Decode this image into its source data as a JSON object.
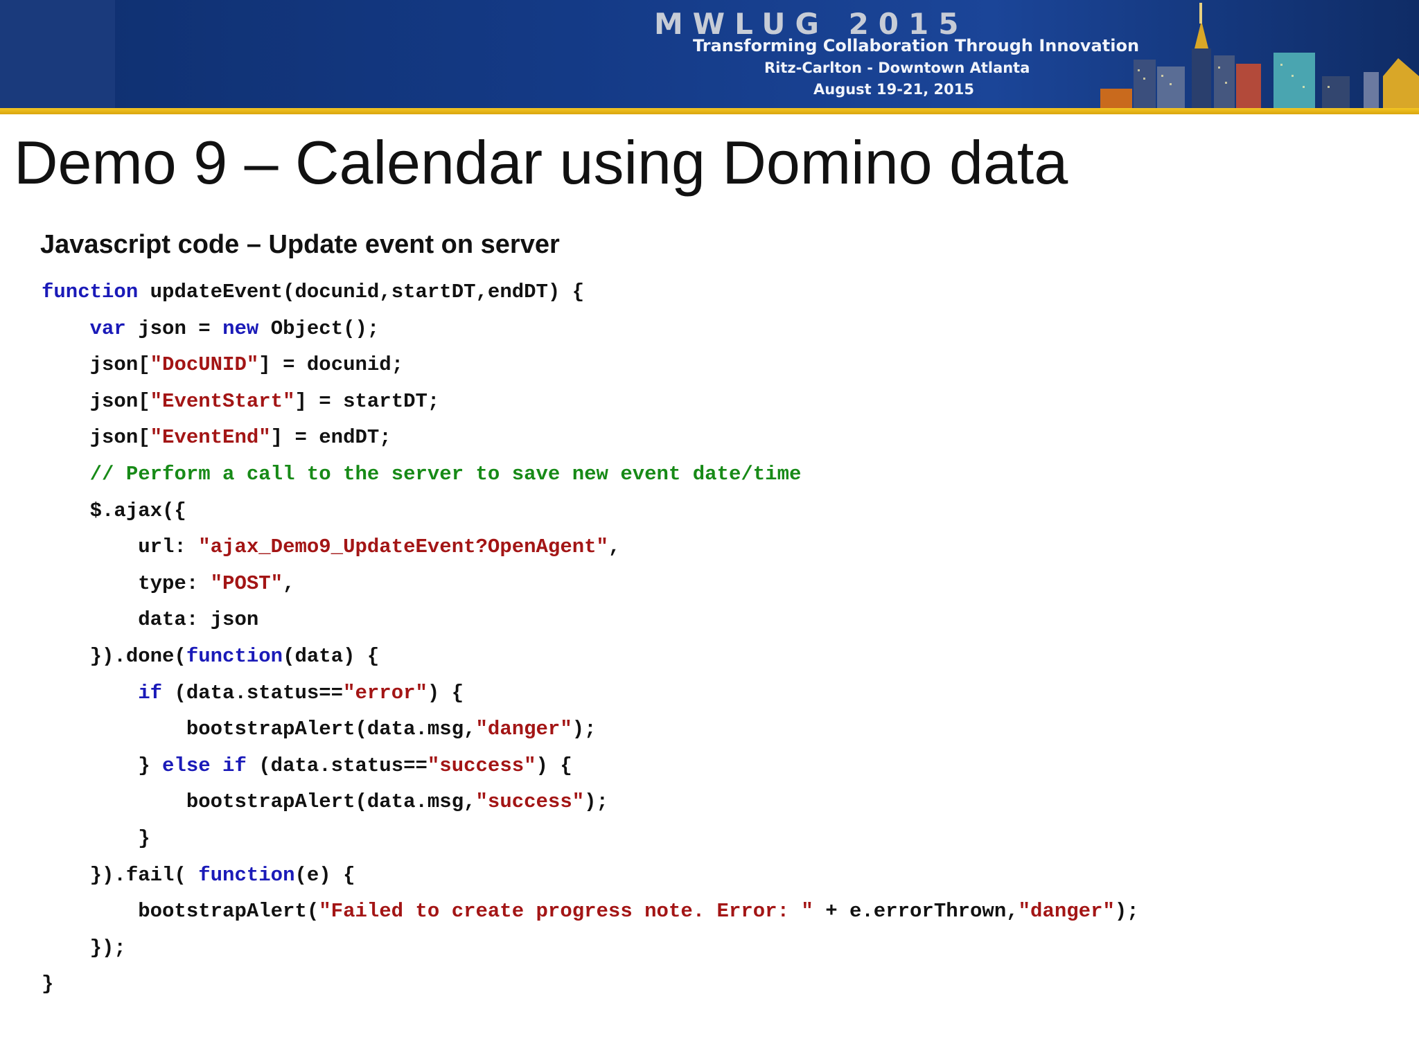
{
  "banner": {
    "conference": "MWLUG 2015",
    "tagline": "Transforming Collaboration Through Innovation",
    "venue": "Ritz-Carlton - Downtown Atlanta",
    "dates": "August 19-21, 2015",
    "colors": {
      "banner": "#143a86",
      "accent_bar": "#e6b414"
    }
  },
  "slide": {
    "title": "Demo 9 – Calendar using Domino data",
    "subtitle": "Javascript code – Update event on server"
  },
  "code": {
    "colors": {
      "keyword": "#1a1ab8",
      "string": "#a31515",
      "comment": "#178a17",
      "plain": "#111111"
    },
    "lines": [
      [
        {
          "t": "kw",
          "v": "function"
        },
        {
          "t": "p",
          "v": " updateEvent(docunid,startDT,endDT) {"
        }
      ],
      [
        {
          "t": "p",
          "v": "    "
        },
        {
          "t": "kw",
          "v": "var"
        },
        {
          "t": "p",
          "v": " json = "
        },
        {
          "t": "kw",
          "v": "new"
        },
        {
          "t": "p",
          "v": " Object();"
        }
      ],
      [
        {
          "t": "p",
          "v": "    json["
        },
        {
          "t": "str",
          "v": "\"DocUNID\""
        },
        {
          "t": "p",
          "v": "] = docunid;"
        }
      ],
      [
        {
          "t": "p",
          "v": "    json["
        },
        {
          "t": "str",
          "v": "\"EventStart\""
        },
        {
          "t": "p",
          "v": "] = startDT;"
        }
      ],
      [
        {
          "t": "p",
          "v": "    json["
        },
        {
          "t": "str",
          "v": "\"EventEnd\""
        },
        {
          "t": "p",
          "v": "] = endDT;"
        }
      ],
      [
        {
          "t": "p",
          "v": "    "
        },
        {
          "t": "cm",
          "v": "// Perform a call to the server to save new event date/time"
        }
      ],
      [
        {
          "t": "p",
          "v": "    $.ajax({"
        }
      ],
      [
        {
          "t": "p",
          "v": "        url: "
        },
        {
          "t": "str",
          "v": "\"ajax_Demo9_UpdateEvent?OpenAgent\""
        },
        {
          "t": "p",
          "v": ","
        }
      ],
      [
        {
          "t": "p",
          "v": "        type: "
        },
        {
          "t": "str",
          "v": "\"POST\""
        },
        {
          "t": "p",
          "v": ","
        }
      ],
      [
        {
          "t": "p",
          "v": "        data: json"
        }
      ],
      [
        {
          "t": "p",
          "v": "    }).done("
        },
        {
          "t": "kw",
          "v": "function"
        },
        {
          "t": "p",
          "v": "(data) {"
        }
      ],
      [
        {
          "t": "p",
          "v": "        "
        },
        {
          "t": "kw",
          "v": "if"
        },
        {
          "t": "p",
          "v": " (data.status=="
        },
        {
          "t": "str",
          "v": "\"error\""
        },
        {
          "t": "p",
          "v": ") {"
        }
      ],
      [
        {
          "t": "p",
          "v": "            bootstrapAlert(data.msg,"
        },
        {
          "t": "str",
          "v": "\"danger\""
        },
        {
          "t": "p",
          "v": ");"
        }
      ],
      [
        {
          "t": "p",
          "v": "        } "
        },
        {
          "t": "kw",
          "v": "else if"
        },
        {
          "t": "p",
          "v": " (data.status=="
        },
        {
          "t": "str",
          "v": "\"success\""
        },
        {
          "t": "p",
          "v": ") {"
        }
      ],
      [
        {
          "t": "p",
          "v": "            bootstrapAlert(data.msg,"
        },
        {
          "t": "str",
          "v": "\"success\""
        },
        {
          "t": "p",
          "v": ");"
        }
      ],
      [
        {
          "t": "p",
          "v": "        }"
        }
      ],
      [
        {
          "t": "p",
          "v": "    }).fail( "
        },
        {
          "t": "kw",
          "v": "function"
        },
        {
          "t": "p",
          "v": "(e) {"
        }
      ],
      [
        {
          "t": "p",
          "v": "        bootstrapAlert("
        },
        {
          "t": "str",
          "v": "\"Failed to create progress note. Error: \""
        },
        {
          "t": "p",
          "v": " + e.errorThrown,"
        },
        {
          "t": "str",
          "v": "\"danger\""
        },
        {
          "t": "p",
          "v": ");"
        }
      ],
      [
        {
          "t": "p",
          "v": "    });"
        }
      ],
      [
        {
          "t": "p",
          "v": "}"
        }
      ]
    ]
  }
}
